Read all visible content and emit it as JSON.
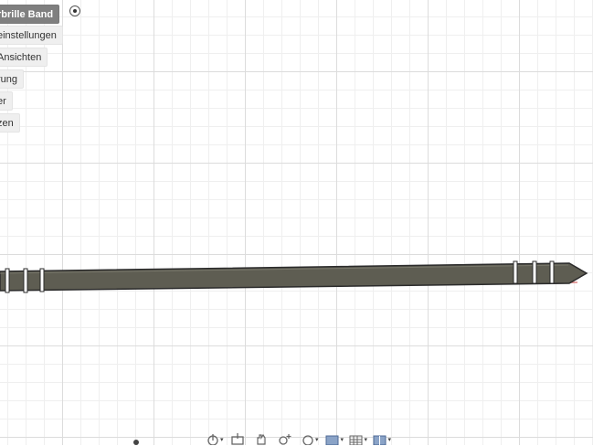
{
  "browser": {
    "items": [
      {
        "label": "rbrille Band",
        "selected": true
      },
      {
        "label": "einstellungen",
        "selected": false
      },
      {
        "label": "Ansichten",
        "selected": false
      },
      {
        "label": "rung",
        "selected": false
      },
      {
        "label": "er",
        "selected": false
      },
      {
        "label": "zen",
        "selected": false
      }
    ]
  },
  "model": {
    "body_color": "#5e5d52",
    "edge_color": "#2b2b2b",
    "ground_line_color": "#d66a6a"
  },
  "toolbar": {
    "buttons": [
      {
        "icon": "orbit-icon",
        "has_dropdown": true
      },
      {
        "icon": "look-at-icon",
        "has_dropdown": false
      },
      {
        "icon": "pan-hand-icon",
        "has_dropdown": false
      },
      {
        "icon": "zoom-icon",
        "has_dropdown": true
      },
      {
        "icon": "fit-view-icon",
        "has_dropdown": true
      },
      {
        "icon": "display-settings-icon",
        "has_dropdown": true
      },
      {
        "icon": "grid-settings-icon",
        "has_dropdown": true
      },
      {
        "icon": "viewports-icon",
        "has_dropdown": true
      }
    ]
  }
}
